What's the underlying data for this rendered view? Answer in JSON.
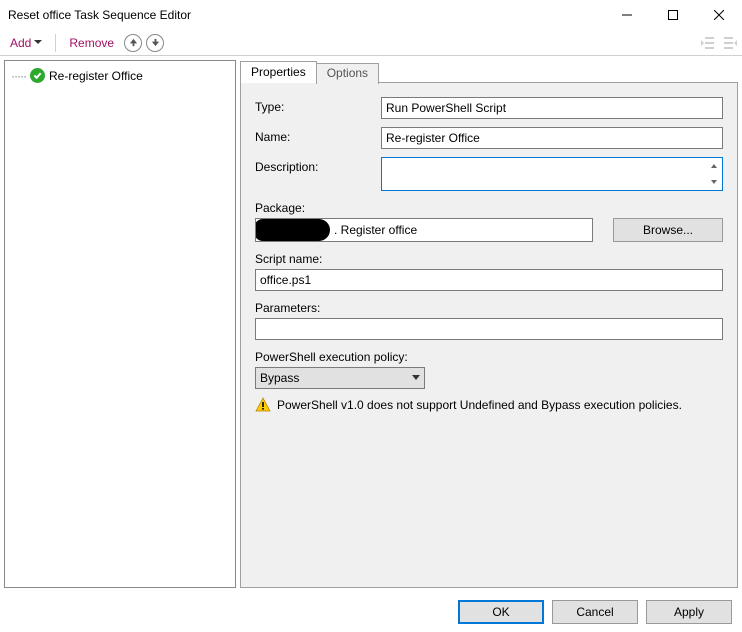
{
  "window": {
    "title": "Reset office Task Sequence Editor"
  },
  "toolbar": {
    "add": "Add",
    "remove": "Remove"
  },
  "tree": {
    "items": [
      {
        "label": "Re-register Office"
      }
    ]
  },
  "tabs": {
    "properties": "Properties",
    "options": "Options"
  },
  "form": {
    "type_lbl": "Type:",
    "type_val": "Run PowerShell Script",
    "name_lbl": "Name:",
    "name_val": "Re-register Office",
    "desc_lbl": "Description:",
    "desc_val": "",
    "package_lbl": "Package:",
    "package_val": ". Register office",
    "browse": "Browse...",
    "script_lbl": "Script name:",
    "script_val": "office.ps1",
    "params_lbl": "Parameters:",
    "params_val": "",
    "policy_lbl": "PowerShell execution policy:",
    "policy_val": "Bypass",
    "warning": "PowerShell v1.0 does not support Undefined and Bypass execution policies."
  },
  "footer": {
    "ok": "OK",
    "cancel": "Cancel",
    "apply": "Apply"
  }
}
